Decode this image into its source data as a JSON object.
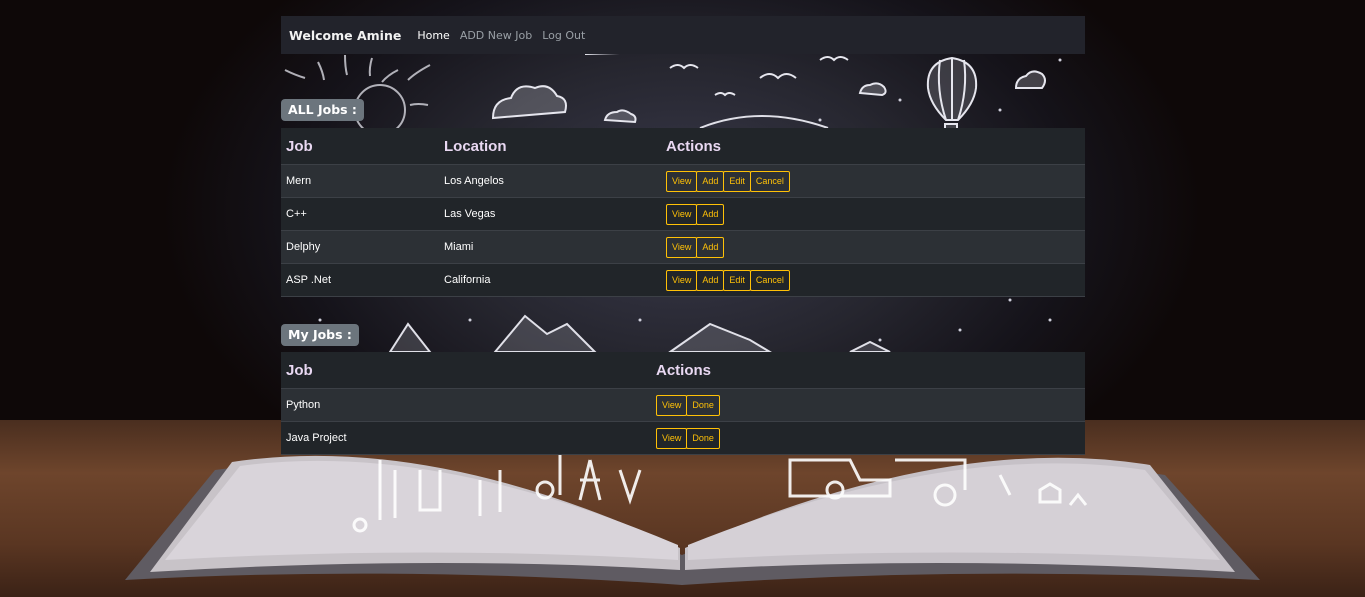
{
  "navbar": {
    "brand": "Welcome Amine",
    "links": [
      "Home",
      "ADD New Job",
      "Log Out"
    ]
  },
  "all_jobs": {
    "badge": "ALL Jobs :",
    "headers": [
      "Job",
      "Location",
      "Actions"
    ],
    "rows": [
      {
        "job": "Mern",
        "location": "Los Angelos",
        "actions": [
          "View",
          "Add",
          "Edit",
          "Cancel"
        ]
      },
      {
        "job": "C++",
        "location": "Las Vegas",
        "actions": [
          "View",
          "Add"
        ]
      },
      {
        "job": "Delphy",
        "location": "Miami",
        "actions": [
          "View",
          "Add"
        ]
      },
      {
        "job": "ASP .Net",
        "location": "California",
        "actions": [
          "View",
          "Add",
          "Edit",
          "Cancel"
        ]
      }
    ]
  },
  "my_jobs": {
    "badge": "My Jobs :",
    "headers": [
      "Job",
      "Actions"
    ],
    "rows": [
      {
        "job": "Python",
        "actions": [
          "View",
          "Done"
        ]
      },
      {
        "job": "Java Project",
        "actions": [
          "View",
          "Done"
        ]
      }
    ]
  },
  "colors": {
    "navbar_bg": "#22232b",
    "table_dark": "#212529",
    "table_stripe": "#2c3035",
    "button_warning": "#ffc107",
    "badge_bg": "#6c757d"
  }
}
